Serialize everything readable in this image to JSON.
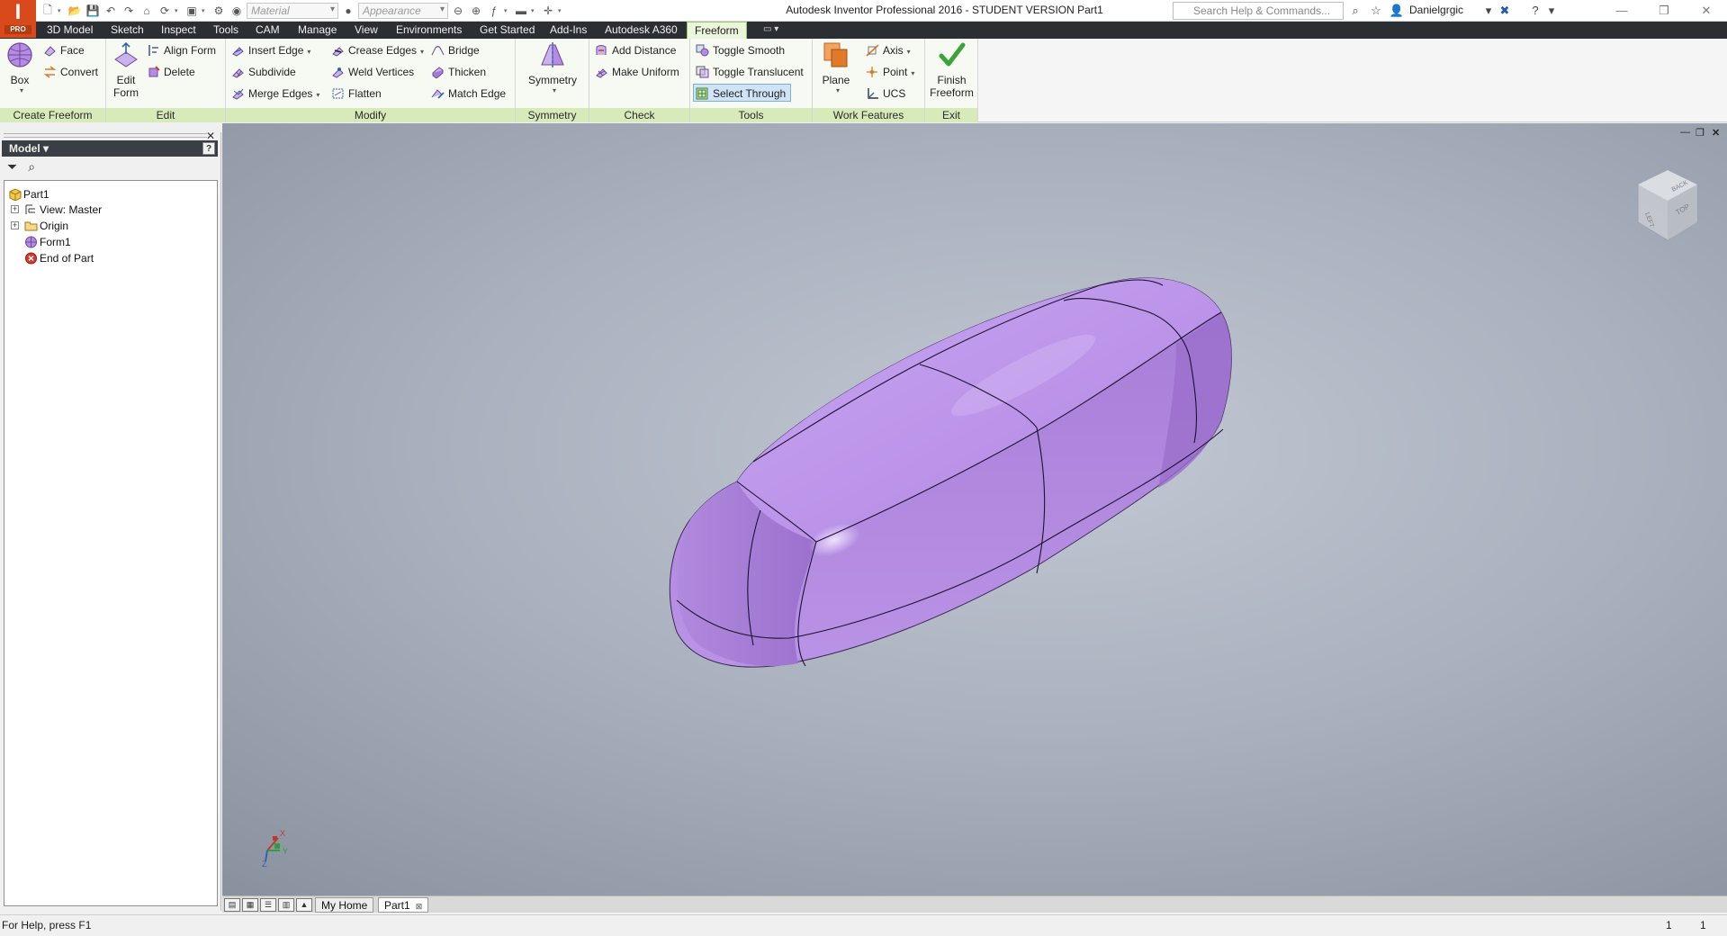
{
  "app": {
    "logo_text": "I",
    "logo_badge": "PRO",
    "window_title": "Autodesk Inventor Professional 2016 - STUDENT VERSION    Part1",
    "search_placeholder": "Search Help & Commands...",
    "user_name": "Danielgrgic"
  },
  "qat": {
    "material_placeholder": "Material",
    "appearance_placeholder": "Appearance"
  },
  "menu_tabs": [
    "3D Model",
    "Sketch",
    "Inspect",
    "Tools",
    "CAM",
    "Manage",
    "View",
    "Environments",
    "Get Started",
    "Add-Ins",
    "Autodesk A360",
    "Freeform"
  ],
  "active_tab": "Freeform",
  "ribbon": {
    "create_freeform": {
      "title": "Create Freeform",
      "box": "Box",
      "face": "Face",
      "convert": "Convert"
    },
    "edit": {
      "title": "Edit",
      "edit_form": "Edit\nForm",
      "edit_form_l1": "Edit",
      "edit_form_l2": "Form",
      "align_form": "Align Form",
      "delete": "Delete"
    },
    "modify": {
      "title": "Modify",
      "insert_edge": "Insert Edge",
      "subdivide": "Subdivide",
      "merge_edges": "Merge Edges",
      "crease_edges": "Crease Edges",
      "weld_vertices": "Weld Vertices",
      "flatten": "Flatten",
      "bridge": "Bridge",
      "thicken": "Thicken",
      "match_edge": "Match Edge"
    },
    "symmetry": {
      "title": "Symmetry",
      "symmetry": "Symmetry"
    },
    "check": {
      "title": "Check",
      "add_distance": "Add Distance",
      "make_uniform": "Make Uniform"
    },
    "tools": {
      "title": "Tools",
      "toggle_smooth": "Toggle Smooth",
      "toggle_translucent": "Toggle Translucent",
      "select_through": "Select Through"
    },
    "work_features": {
      "title": "Work Features",
      "plane": "Plane",
      "axis": "Axis",
      "point": "Point",
      "ucs": "UCS"
    },
    "exit": {
      "title": "Exit",
      "finish_l1": "Finish",
      "finish_l2": "Freeform"
    }
  },
  "browser": {
    "title": "Model",
    "help": "?",
    "tree": [
      "Part1",
      "View: Master",
      "Origin",
      "Form1",
      "End of Part"
    ]
  },
  "viewcube": {
    "top_label": "TOP",
    "back_label": "BACK",
    "left_label": "LEFT"
  },
  "triad": {
    "x": "X",
    "y": "Y",
    "z": "Z"
  },
  "doc_tabs": [
    "My Home",
    "Part1"
  ],
  "status": {
    "help_text": "For Help, press F1",
    "count_1": "1",
    "count_2": "1"
  },
  "colors": {
    "form_fill": "#b48ee0",
    "ribbon_panel_title": "#d6ebb9",
    "menu_bar": "#2b2f33",
    "logo": "#d84a1b"
  }
}
